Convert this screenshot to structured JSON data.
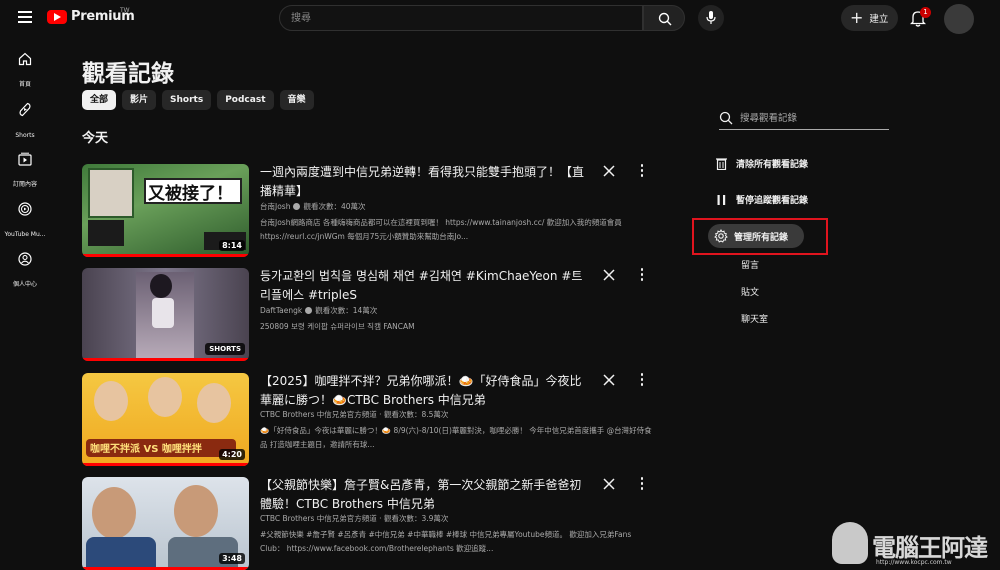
{
  "header": {
    "logo_text": "Premium",
    "logo_region": "TW",
    "search_placeholder": "搜尋",
    "create_label": "建立",
    "notification_count": "1"
  },
  "sidebar": {
    "items": [
      {
        "label": "首頁",
        "icon": "home-icon"
      },
      {
        "label": "Shorts",
        "icon": "shorts-icon"
      },
      {
        "label": "訂閱內容",
        "icon": "subscriptions-icon"
      },
      {
        "label": "YouTube Mu...",
        "icon": "youtube-music-icon"
      },
      {
        "label": "個人中心",
        "icon": "profile-icon"
      }
    ]
  },
  "main": {
    "title": "觀看記錄",
    "chips": [
      "全部",
      "影片",
      "Shorts",
      "Podcast",
      "音樂"
    ],
    "section_title": "今天",
    "videos": [
      {
        "title": "一週內兩度遭到中信兄弟逆轉！看得我只能雙手抱頭了！【直播精華】",
        "channel": "台南Josh",
        "views": "觀看次數：40萬次",
        "desc": "台南Josh網路商店 各種嗨嗨商品都可以在這裡買到喔！ https://www.tainanjosh.cc/ 歡迎加入我的頻道會員 https://reurl.cc/jnWGm 每個月75元小額贊助來幫助台南Jo...",
        "duration": "8:14",
        "thumb_text": "又被接了！",
        "progress": 1.0
      },
      {
        "title": "등가교환의 법칙을 명심해 채연 #김채연 #KimChaeYeon #트리플에스 #tripleS",
        "channel": "DaftTaengk",
        "views": "觀看次數：14萬次",
        "desc": "250809 보령 케이팝 슈퍼라이브 직캠 FANCAM",
        "duration": "SHORTS",
        "progress": 1.0
      },
      {
        "title": "【2025】咖哩拌不拌？兄弟你哪派！🍛「好侍食品」今夜比華麗に勝つ！🍛CTBC Brothers 中信兄弟",
        "channel": "CTBC Brothers 中信兄弟官方頻道",
        "views": "觀看次數：8.5萬次",
        "desc": "🍛「好侍食品」今夜は華麗に勝つ！🍛 8/9(六)-8/10(日)華麗對決，咖哩必勝！ 今年中信兄弟首度攜手 @台灣好侍食品 打造咖哩主題日，邀請所有球...",
        "duration": "4:20",
        "thumb_text": "咖哩不拌派 VS 咖哩拌拌",
        "progress": 1.0
      },
      {
        "title": "【父親節快樂】詹子賢&呂彥青，第一次父親節之新手爸爸初體驗！CTBC Brothers 中信兄弟",
        "channel": "CTBC Brothers 中信兄弟官方頻道",
        "views": "觀看次數：3.9萬次",
        "desc": "#父親節快樂 #詹子賢 #呂彥青 #中信兄弟 #中華職棒 #棒球 中信兄弟專屬Youtube頻道。 歡迎加入兄弟Fans Club： https://www.facebook.com/Brotherelephants 歡迎追蹤...",
        "duration": "3:48",
        "progress": 1.0
      }
    ]
  },
  "panel": {
    "search_placeholder": "搜尋觀看記錄",
    "clear_label": "清除所有觀看記錄",
    "pause_label": "暫停追蹤觀看記錄",
    "manage_label": "管理所有記錄",
    "sub_items": [
      "留言",
      "貼文",
      "聊天室"
    ]
  },
  "watermark": {
    "text": "電腦王阿達",
    "url": "http://www.kocpc.com.tw"
  },
  "colors": {
    "background": "#0f0f0f",
    "accent_red": "#ff0000",
    "highlight_box": "#e0141e"
  }
}
